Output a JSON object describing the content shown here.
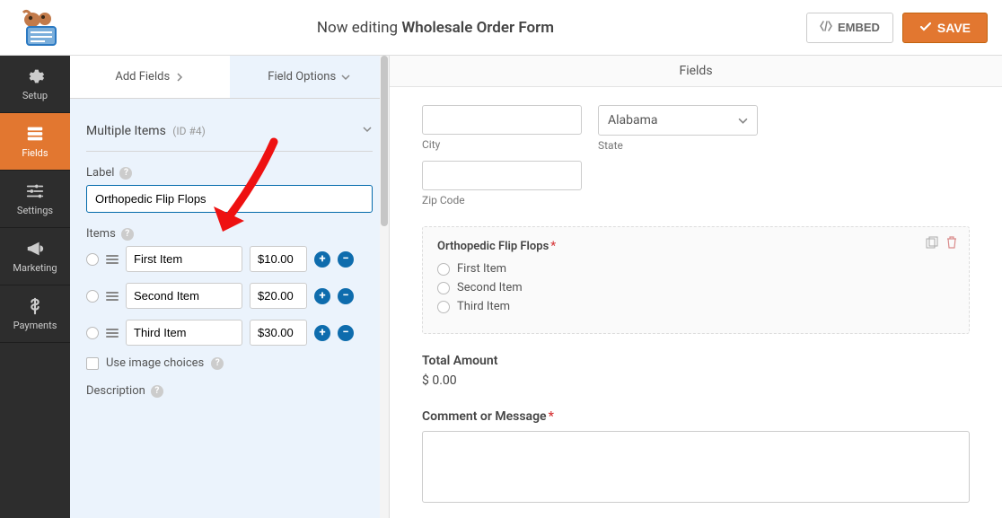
{
  "topbar": {
    "editing_prefix": "Now editing",
    "form_name": "Wholesale Order Form",
    "embed_label": "EMBED",
    "save_label": "SAVE"
  },
  "vnav": {
    "setup": "Setup",
    "fields": "Fields",
    "settings": "Settings",
    "marketing": "Marketing",
    "payments": "Payments"
  },
  "panel": {
    "tab_add": "Add Fields",
    "tab_options": "Field Options",
    "section_name": "Multiple Items",
    "section_id": "(ID #4)",
    "label_label": "Label",
    "label_value": "Orthopedic Flip Flops",
    "items_label": "Items",
    "items": [
      {
        "name": "First Item",
        "price": "$10.00"
      },
      {
        "name": "Second Item",
        "price": "$20.00"
      },
      {
        "name": "Third Item",
        "price": "$30.00"
      }
    ],
    "use_image_choices": "Use image choices",
    "description_label": "Description"
  },
  "preview": {
    "header": "Fields",
    "city_label": "City",
    "state_value": "Alabama",
    "state_label": "State",
    "zip_label": "Zip Code",
    "fieldset_title": "Orthopedic Flip Flops",
    "option1": "First Item",
    "option2": "Second Item",
    "option3": "Third Item",
    "total_label": "Total Amount",
    "total_value": "$ 0.00",
    "comment_label": "Comment or Message"
  }
}
